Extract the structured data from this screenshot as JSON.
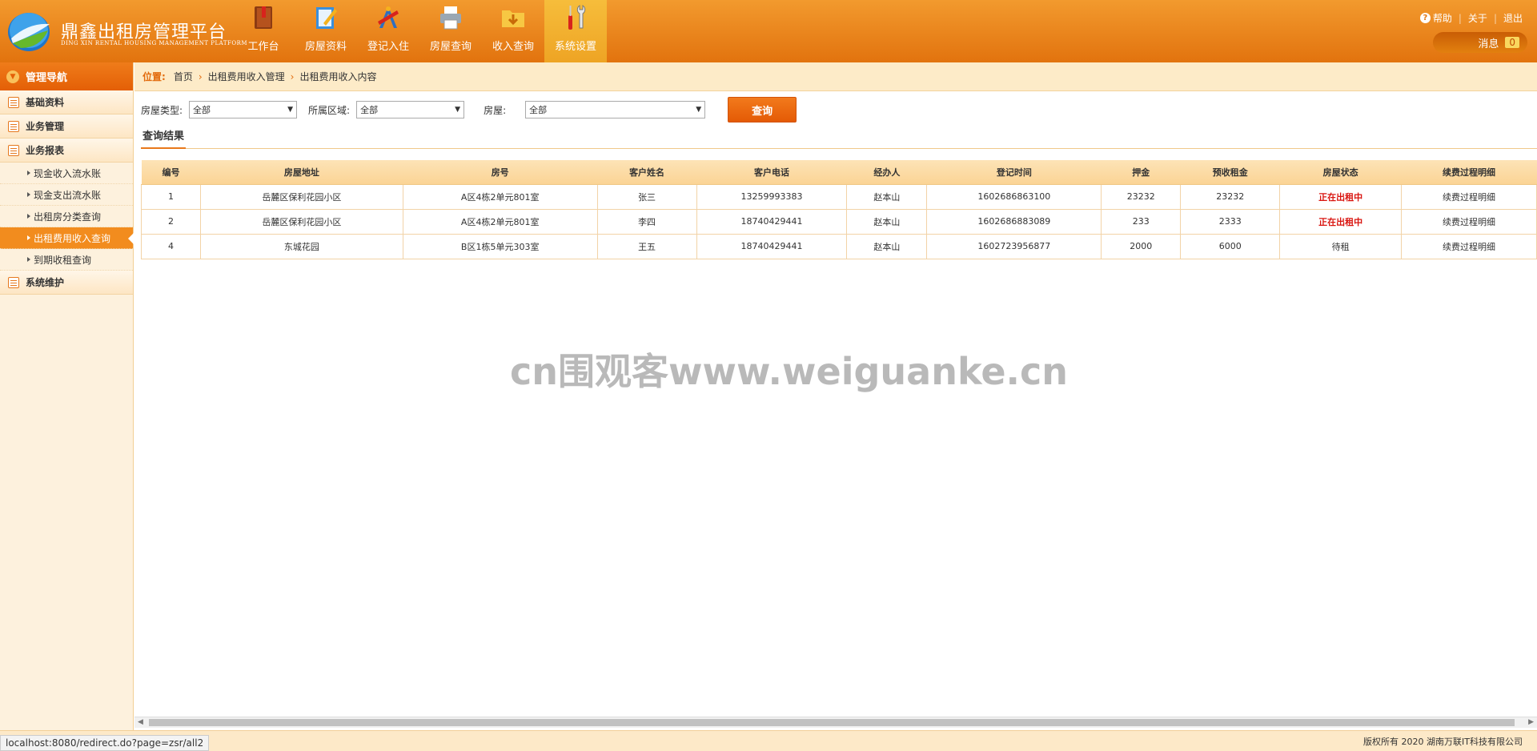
{
  "header": {
    "app_title": "鼎鑫出租房管理平台",
    "app_subtitle": "DING XIN RENTAL HOUSING MANAGEMENT PLATFORM",
    "nav": [
      {
        "label": "工作台",
        "icon": "book-icon"
      },
      {
        "label": "房屋资料",
        "icon": "notebook-pencil-icon"
      },
      {
        "label": "登记入住",
        "icon": "drafting-tools-icon"
      },
      {
        "label": "房屋查询",
        "icon": "printer-icon"
      },
      {
        "label": "收入查询",
        "icon": "folder-download-icon"
      },
      {
        "label": "系统设置",
        "icon": "wrench-screwdriver-icon",
        "active": true
      }
    ],
    "links": {
      "help": "帮助",
      "about": "关于",
      "logout": "退出"
    },
    "messages_label": "消息",
    "messages_count": "0"
  },
  "sidebar": {
    "title": "管理导航",
    "groups": [
      {
        "label": "基础资料"
      },
      {
        "label": "业务管理"
      },
      {
        "label": "业务报表",
        "items": [
          "现金收入流水账",
          "现金支出流水账",
          "出租房分类查询",
          "出租费用收入查询",
          "到期收租查询"
        ],
        "active_item": "出租费用收入查询"
      },
      {
        "label": "系统维护"
      }
    ]
  },
  "breadcrumb": {
    "label": "位置:",
    "items": [
      "首页",
      "出租费用收入管理",
      "出租费用收入内容"
    ]
  },
  "filters": {
    "house_type_label": "房屋类型:",
    "house_type_value": "全部",
    "region_label": "所属区域:",
    "region_value": "全部",
    "house_label": "房屋:",
    "house_value": "全部",
    "query_button": "查询"
  },
  "results": {
    "tab_label": "查询结果",
    "columns": [
      "编号",
      "房屋地址",
      "房号",
      "客户姓名",
      "客户电话",
      "经办人",
      "登记时间",
      "押金",
      "预收租金",
      "房屋状态",
      "续费过程明细"
    ],
    "rows": [
      [
        "1",
        "岳麓区保利花园小区",
        "A区4栋2单元801室",
        "张三",
        "13259993383",
        "赵本山",
        "1602686863100",
        "23232",
        "23232",
        "正在出租中",
        "续费过程明细"
      ],
      [
        "2",
        "岳麓区保利花园小区",
        "A区4栋2单元801室",
        "李四",
        "18740429441",
        "赵本山",
        "1602686883089",
        "233",
        "2333",
        "正在出租中",
        "续费过程明细"
      ],
      [
        "4",
        "东城花园",
        "B区1栋5单元303室",
        "王五",
        "18740429441",
        "赵本山",
        "1602723956877",
        "2000",
        "6000",
        "待租",
        "续费过程明细"
      ]
    ]
  },
  "watermark": "cn围观客www.weiguanke.cn",
  "status_url": "localhost:8080/redirect.do?page=zsr/all2",
  "copyright": "版权所有 2020 湖南万联IT科技有限公司",
  "colors": {
    "brand_orange": "#e2730e",
    "active_red": "#d9140f",
    "sidebar_bg": "#fdf1dd"
  }
}
